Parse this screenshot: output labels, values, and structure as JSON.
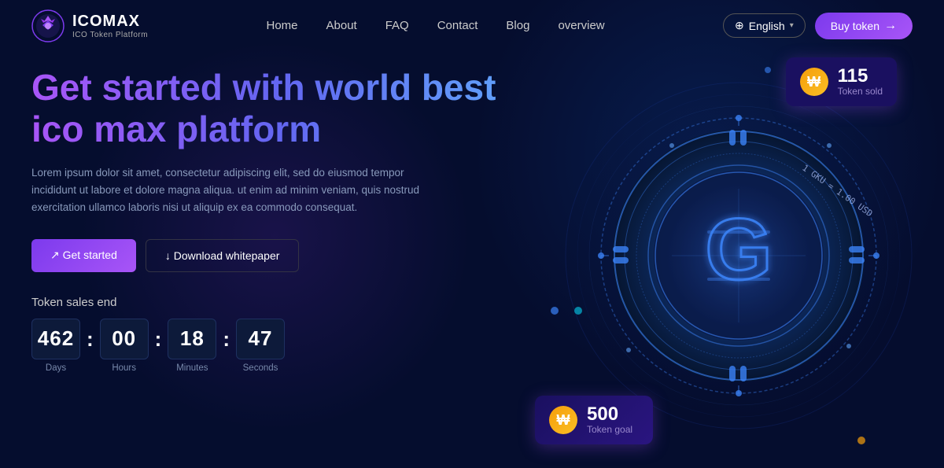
{
  "brand": {
    "name": "ICOMAX",
    "subtitle": "ICO Token Platform",
    "logo_letter": "G"
  },
  "nav": {
    "links": [
      {
        "label": "Home",
        "id": "home"
      },
      {
        "label": "About",
        "id": "about"
      },
      {
        "label": "FAQ",
        "id": "faq"
      },
      {
        "label": "Contact",
        "id": "contact"
      },
      {
        "label": "Blog",
        "id": "blog"
      },
      {
        "label": "overview",
        "id": "overview"
      }
    ],
    "language": "English",
    "buy_token_label": "Buy token",
    "buy_token_arrow": "→"
  },
  "hero": {
    "title": "Get started with world best ico max platform",
    "description": "Lorem ipsum dolor sit amet, consectetur adipiscing elit, sed do eiusmod tempor incididunt ut labore et dolore magna aliqua. ut enim ad minim veniam, quis nostrud exercitation ullamco laboris nisi ut aliquip ex ea commodo consequat.",
    "btn_primary": "↗ Get started",
    "btn_secondary": "↓ Download whitepaper"
  },
  "countdown": {
    "label": "Token sales end",
    "days": {
      "value": "462",
      "unit": "Days"
    },
    "hours": {
      "value": "00",
      "unit": "Hours"
    },
    "minutes": {
      "value": "18",
      "unit": "Minutes"
    },
    "seconds": {
      "value": "47",
      "unit": "Seconds"
    }
  },
  "token_sold": {
    "number": "115",
    "label": "Token sold"
  },
  "token_goal": {
    "number": "500",
    "label": "Token goal"
  },
  "coin": {
    "symbol": "G",
    "rate_label": "1 GKU = 1.00 USD"
  },
  "colors": {
    "accent_purple": "#a855f7",
    "accent_blue": "#3b82f6",
    "bg_dark": "#050d2e",
    "bg_card": "#0d1a3a"
  }
}
